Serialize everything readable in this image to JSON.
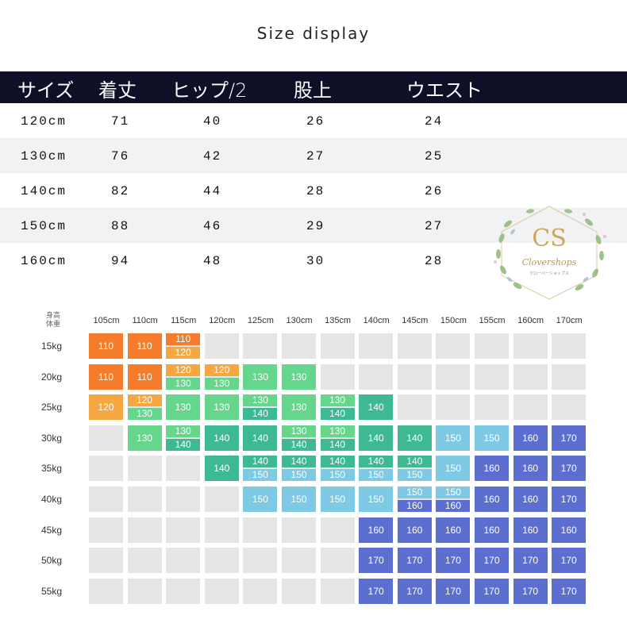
{
  "title": "Size display",
  "size_table": {
    "headers": [
      "サイズ",
      "着丈",
      "ヒップ/2",
      "股上",
      "ウエスト"
    ],
    "rows": [
      [
        "120cm",
        "71",
        "40",
        "26",
        "24"
      ],
      [
        "130cm",
        "76",
        "42",
        "27",
        "25"
      ],
      [
        "140cm",
        "82",
        "44",
        "28",
        "26"
      ],
      [
        "150cm",
        "88",
        "46",
        "29",
        "27"
      ],
      [
        "160cm",
        "94",
        "48",
        "30",
        "28"
      ]
    ]
  },
  "logo": {
    "monogram": "CS",
    "name": "Clovershops",
    "sub": "クローバーショップス"
  },
  "chart": {
    "corner_label": [
      "身高",
      "体重"
    ],
    "columns": [
      "105cm",
      "110cm",
      "115cm",
      "120cm",
      "125cm",
      "130cm",
      "135cm",
      "140cm",
      "145cm",
      "150cm",
      "155cm",
      "160cm",
      "170cm"
    ],
    "rows": [
      {
        "weight": "15kg",
        "cells": [
          [
            "110"
          ],
          [
            "110"
          ],
          [
            "110",
            "120"
          ],
          [],
          [],
          [],
          [],
          [],
          [],
          [],
          [],
          [],
          []
        ]
      },
      {
        "weight": "20kg",
        "cells": [
          [
            "110"
          ],
          [
            "110"
          ],
          [
            "120",
            "130"
          ],
          [
            "120",
            "130"
          ],
          [
            "130"
          ],
          [
            "130"
          ],
          [],
          [],
          [],
          [],
          [],
          [],
          []
        ]
      },
      {
        "weight": "25kg",
        "cells": [
          [
            "120"
          ],
          [
            "120",
            "130"
          ],
          [
            "130"
          ],
          [
            "130"
          ],
          [
            "130",
            "140"
          ],
          [
            "130"
          ],
          [
            "130",
            "140"
          ],
          [
            "140"
          ],
          [],
          [],
          [],
          [],
          []
        ]
      },
      {
        "weight": "30kg",
        "cells": [
          [],
          [
            "130"
          ],
          [
            "130",
            "140"
          ],
          [
            "140"
          ],
          [
            "140"
          ],
          [
            "130",
            "140"
          ],
          [
            "130",
            "140"
          ],
          [
            "140"
          ],
          [
            "140"
          ],
          [
            "150"
          ],
          [
            "150"
          ],
          [
            "160"
          ],
          [
            "170"
          ]
        ]
      },
      {
        "weight": "35kg",
        "cells": [
          [],
          [],
          [],
          [
            "140"
          ],
          [
            "140",
            "150"
          ],
          [
            "140",
            "150"
          ],
          [
            "140",
            "150"
          ],
          [
            "140",
            "150"
          ],
          [
            "140",
            "150"
          ],
          [
            "150"
          ],
          [
            "160"
          ],
          [
            "160"
          ],
          [
            "170"
          ]
        ]
      },
      {
        "weight": "40kg",
        "cells": [
          [],
          [],
          [],
          [],
          [
            "150"
          ],
          [
            "150"
          ],
          [
            "150"
          ],
          [
            "150"
          ],
          [
            "150",
            "160"
          ],
          [
            "150",
            "160"
          ],
          [
            "160"
          ],
          [
            "160"
          ],
          [
            "170"
          ]
        ]
      },
      {
        "weight": "45kg",
        "cells": [
          [],
          [],
          [],
          [],
          [],
          [],
          [],
          [
            "160"
          ],
          [
            "160"
          ],
          [
            "160"
          ],
          [
            "160"
          ],
          [
            "160"
          ],
          [
            "160"
          ]
        ]
      },
      {
        "weight": "50kg",
        "cells": [
          [],
          [],
          [],
          [],
          [],
          [],
          [],
          [
            "170"
          ],
          [
            "170"
          ],
          [
            "170"
          ],
          [
            "170"
          ],
          [
            "170"
          ],
          [
            "170"
          ]
        ]
      },
      {
        "weight": "55kg",
        "cells": [
          [],
          [],
          [],
          [],
          [],
          [],
          [],
          [
            "170"
          ],
          [
            "170"
          ],
          [
            "170"
          ],
          [
            "170"
          ],
          [
            "170"
          ],
          [
            "170"
          ]
        ]
      }
    ],
    "colors": {
      "110": "#f47c2a",
      "120": "#f5a742",
      "130": "#66d68c",
      "140": "#3fb894",
      "150": "#7ec9e4",
      "160": "#5c6fd0",
      "170": "#5c6fd0",
      "empty": "#e5e5e5"
    }
  }
}
